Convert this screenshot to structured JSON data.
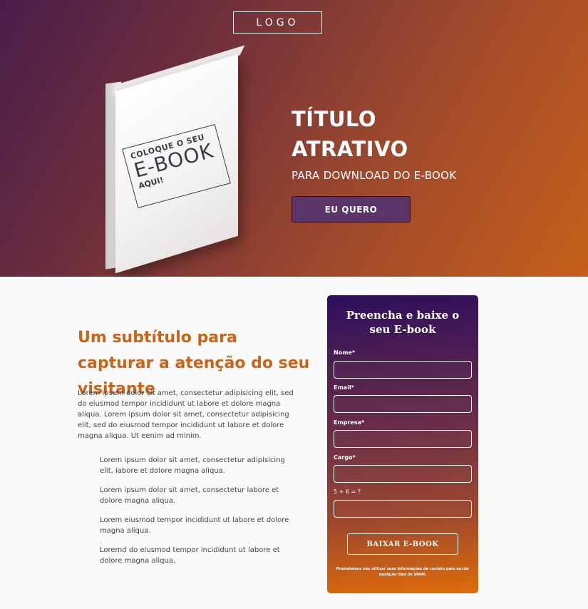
{
  "hero": {
    "logo": "LOGO",
    "book": {
      "line1": "COLOQUE O SEU",
      "line2": "E-BOOK",
      "line3": "AQUI!"
    },
    "title": "TÍTULO ATRATIVO",
    "subtitle": "PARA DOWNLOAD DO E-BOOK",
    "cta_label": "EU QUERO"
  },
  "content": {
    "subtitle": "Um subtítulo para capturar a atenção do seu visitante",
    "paragraph": "Lorem ipsum dolor sit amet, consectetur adipisicing elit, sed do eiusmod tempor incididunt ut labore et dolore magna aliqua. Lorem ipsum dolor sit amet, consectetur adipisicing elit, sed do eiusmod tempor incididunt ut labore et dolore magna aliqua. Ut eenim ad minim.",
    "bullets": [
      "Lorem ipsum dolor sit amet, consectetur adipisicing elit, labore et dolore magna aliqua.",
      "Lorem ipsum dolor sit amet, consectetur labore et dolore magna aliqua.",
      "Lorem eiusmod tempor incididunt ut labore et dolore magna aliqua.",
      "Loremd do eiusmod tempor incididunt ut labore et dolore magna aliqua."
    ]
  },
  "form": {
    "title": "Preencha e baixe o seu E-book",
    "fields": [
      {
        "label": "Nome*",
        "value": ""
      },
      {
        "label": "Email*",
        "value": ""
      },
      {
        "label": "Empresa*",
        "value": ""
      },
      {
        "label": "Cargo*",
        "value": ""
      },
      {
        "label": "5 + 6 = ?",
        "value": ""
      }
    ],
    "submit_label": "BAIXAR E-BOOK",
    "privacy_note": "Prometemos não utilizar suas informações de contato para enviar qualquer tipo de SPAM."
  },
  "colors": {
    "accent_orange": "#c9631a",
    "button_purple": "#5b3568"
  }
}
